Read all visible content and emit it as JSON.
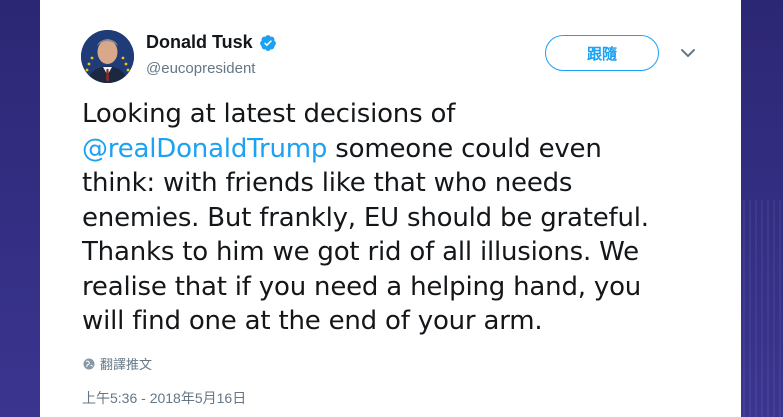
{
  "author": {
    "display_name": "Donald Tusk",
    "handle": "@eucopresident",
    "verified": true
  },
  "follow_button": {
    "label": "跟隨"
  },
  "tweet": {
    "lines": [
      [
        {
          "text": "Looking at latest decisions of",
          "mention": false
        }
      ],
      [
        {
          "text": "@realDonaldTrump",
          "mention": true
        },
        {
          "text": " someone could even",
          "mention": false
        }
      ],
      [
        {
          "text": "think: with friends like that who needs",
          "mention": false
        }
      ],
      [
        {
          "text": "enemies. But frankly, EU should be grateful.",
          "mention": false
        }
      ],
      [
        {
          "text": "Thanks to him we got rid of all illusions. We",
          "mention": false
        }
      ],
      [
        {
          "text": "realise that if you need a helping hand, you",
          "mention": false
        }
      ],
      [
        {
          "text": "will find one at the end of your arm.",
          "mention": false
        }
      ]
    ]
  },
  "translate_label": "翻譯推文",
  "timestamp": "上午5:36 - 2018年5月16日",
  "icons": {
    "verified": "verified-badge-icon",
    "caret": "chevron-down-icon",
    "globe": "globe-icon"
  },
  "colors": {
    "accent": "#1da1f2",
    "text": "#14171a",
    "muted": "#657786",
    "background": "#2f2a78"
  }
}
